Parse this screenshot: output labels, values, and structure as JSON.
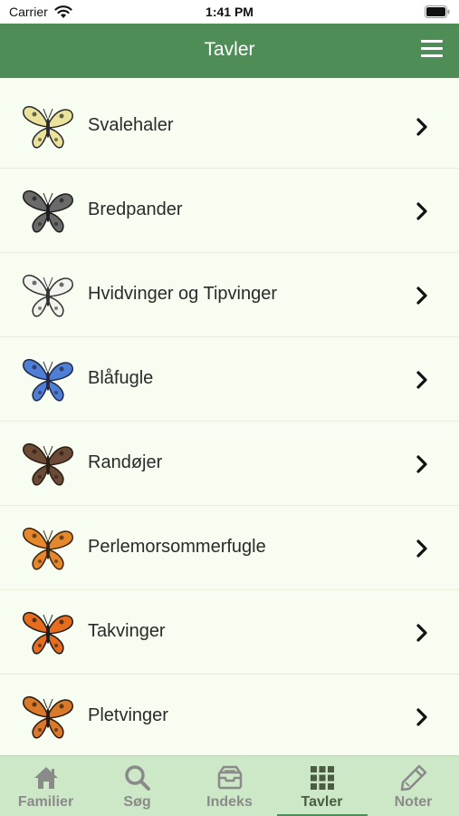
{
  "status": {
    "carrier": "Carrier",
    "time": "1:41 PM"
  },
  "header": {
    "title": "Tavler",
    "menu_icon": "hamburger-menu-icon"
  },
  "list": {
    "items": [
      {
        "label": "Svalehaler",
        "wing": "#ebe39c",
        "body": "#2a2a2a"
      },
      {
        "label": "Bredpander",
        "wing": "#6a6a6a",
        "body": "#1e1e1e"
      },
      {
        "label": "Hvidvinger og Tipvinger",
        "wing": "#f2f2ee",
        "body": "#333333"
      },
      {
        "label": "Blåfugle",
        "wing": "#4f7ed6",
        "body": "#222a44"
      },
      {
        "label": "Randøjer",
        "wing": "#6b4a36",
        "body": "#2a1d14"
      },
      {
        "label": "Perlemorsommerfugle",
        "wing": "#e5882c",
        "body": "#3a2410"
      },
      {
        "label": "Takvinger",
        "wing": "#e66d1e",
        "body": "#1c1c1c"
      },
      {
        "label": "Pletvinger",
        "wing": "#d9792a",
        "body": "#2a1a0e"
      }
    ]
  },
  "tabs": [
    {
      "label": "Familier",
      "icon": "home-icon"
    },
    {
      "label": "Søg",
      "icon": "search-icon"
    },
    {
      "label": "Indeks",
      "icon": "archive-icon"
    },
    {
      "label": "Tavler",
      "icon": "grid-icon",
      "active": true
    },
    {
      "label": "Noter",
      "icon": "pencil-icon"
    }
  ],
  "colors": {
    "accent": "#4f8d57",
    "tab_bar": "#cde8c6",
    "background": "#f8fdf1"
  }
}
